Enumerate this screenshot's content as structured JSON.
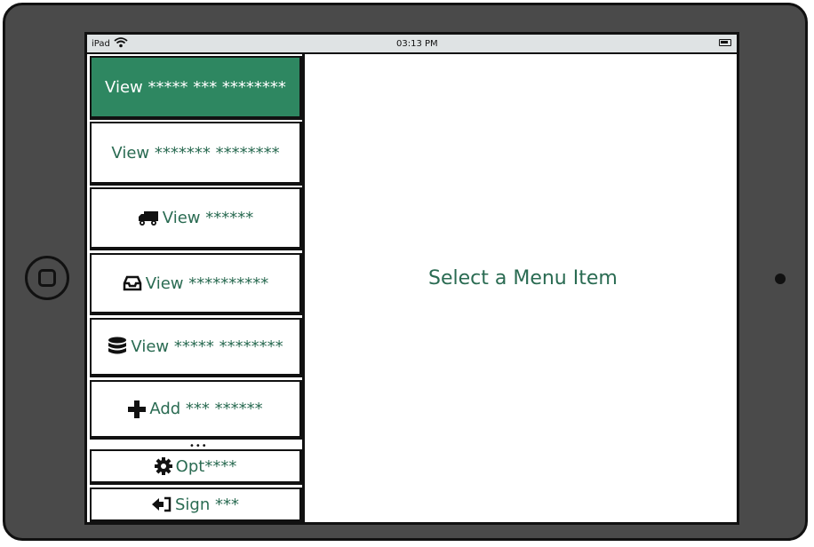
{
  "statusbar": {
    "device": "iPad",
    "time": "03:13 PM"
  },
  "menu": [
    {
      "label": "View ***** *** ********",
      "icon": "",
      "active": true
    },
    {
      "label": "View ******* ********",
      "icon": ""
    },
    {
      "label": "View ******",
      "icon": "truck-icon"
    },
    {
      "label": "View **********",
      "icon": "inbox-icon"
    },
    {
      "label": "View ***** ********",
      "icon": "database-icon"
    },
    {
      "label": "Add *** ******",
      "icon": "plus-icon"
    },
    {
      "label": "Opt****",
      "icon": "gear-icon"
    },
    {
      "label": "Sign ***",
      "icon": "sign-out-icon"
    }
  ],
  "more_indicator": "•••",
  "main": {
    "message": "Select a Menu Item"
  },
  "colors": {
    "accent": "#2e8761",
    "text": "#2a6b52",
    "frame": "#4a4a4a"
  }
}
